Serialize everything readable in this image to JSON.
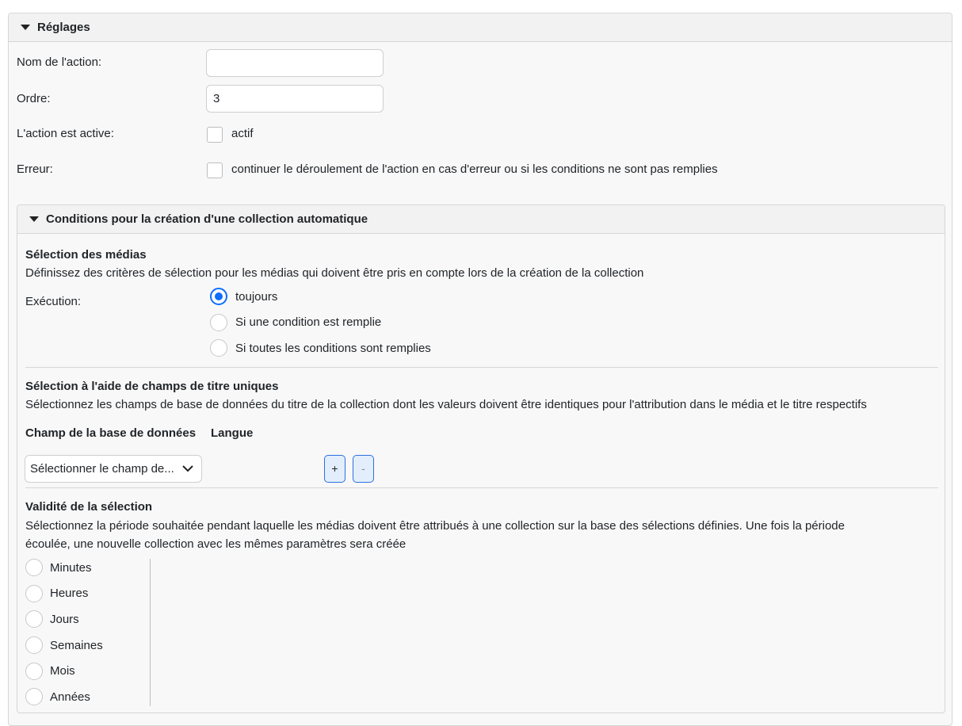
{
  "settings": {
    "title": "Réglages",
    "action_name_label": "Nom de l'action:",
    "action_name_value": "",
    "order_label": "Ordre:",
    "order_value": "3",
    "active_label": "L'action est active:",
    "active_checkbox_label": "actif",
    "error_label": "Erreur:",
    "error_checkbox_label": "continuer le déroulement de l'action en cas d'erreur ou si les conditions ne sont pas remplies"
  },
  "conditions": {
    "title": "Conditions pour la création d'une collection automatique",
    "media_selection": {
      "heading": "Sélection des médias",
      "description": "Définissez des critères de sélection pour les médias qui doivent être pris en compte lors de la création de la collection",
      "execution_label": "Exécution:",
      "options": [
        "toujours",
        "Si une condition est remplie",
        "Si toutes les conditions sont remplies"
      ],
      "selected": "toujours"
    },
    "unique_fields": {
      "heading": "Sélection à l'aide de champs de titre uniques",
      "description": "Sélectionnez les champs de base de données du titre de la collection dont les valeurs doivent être identiques pour l'attribution dans le média et le titre respectifs",
      "col_field": "Champ de la base de données",
      "col_language": "Langue",
      "select_value": "Sélectionner le champ de...",
      "add_label": "+",
      "remove_label": "-"
    },
    "validity": {
      "heading": "Validité de la sélection",
      "description_line1": "Sélectionnez la période souhaitée pendant laquelle les médias doivent être attribués à une collection sur la base des sélections définies. Une fois la période",
      "description_line2": "écoulée, une nouvelle collection avec les mêmes paramètres sera créée",
      "options": [
        "Minutes",
        "Heures",
        "Jours",
        "Semaines",
        "Mois",
        "Années"
      ]
    }
  }
}
